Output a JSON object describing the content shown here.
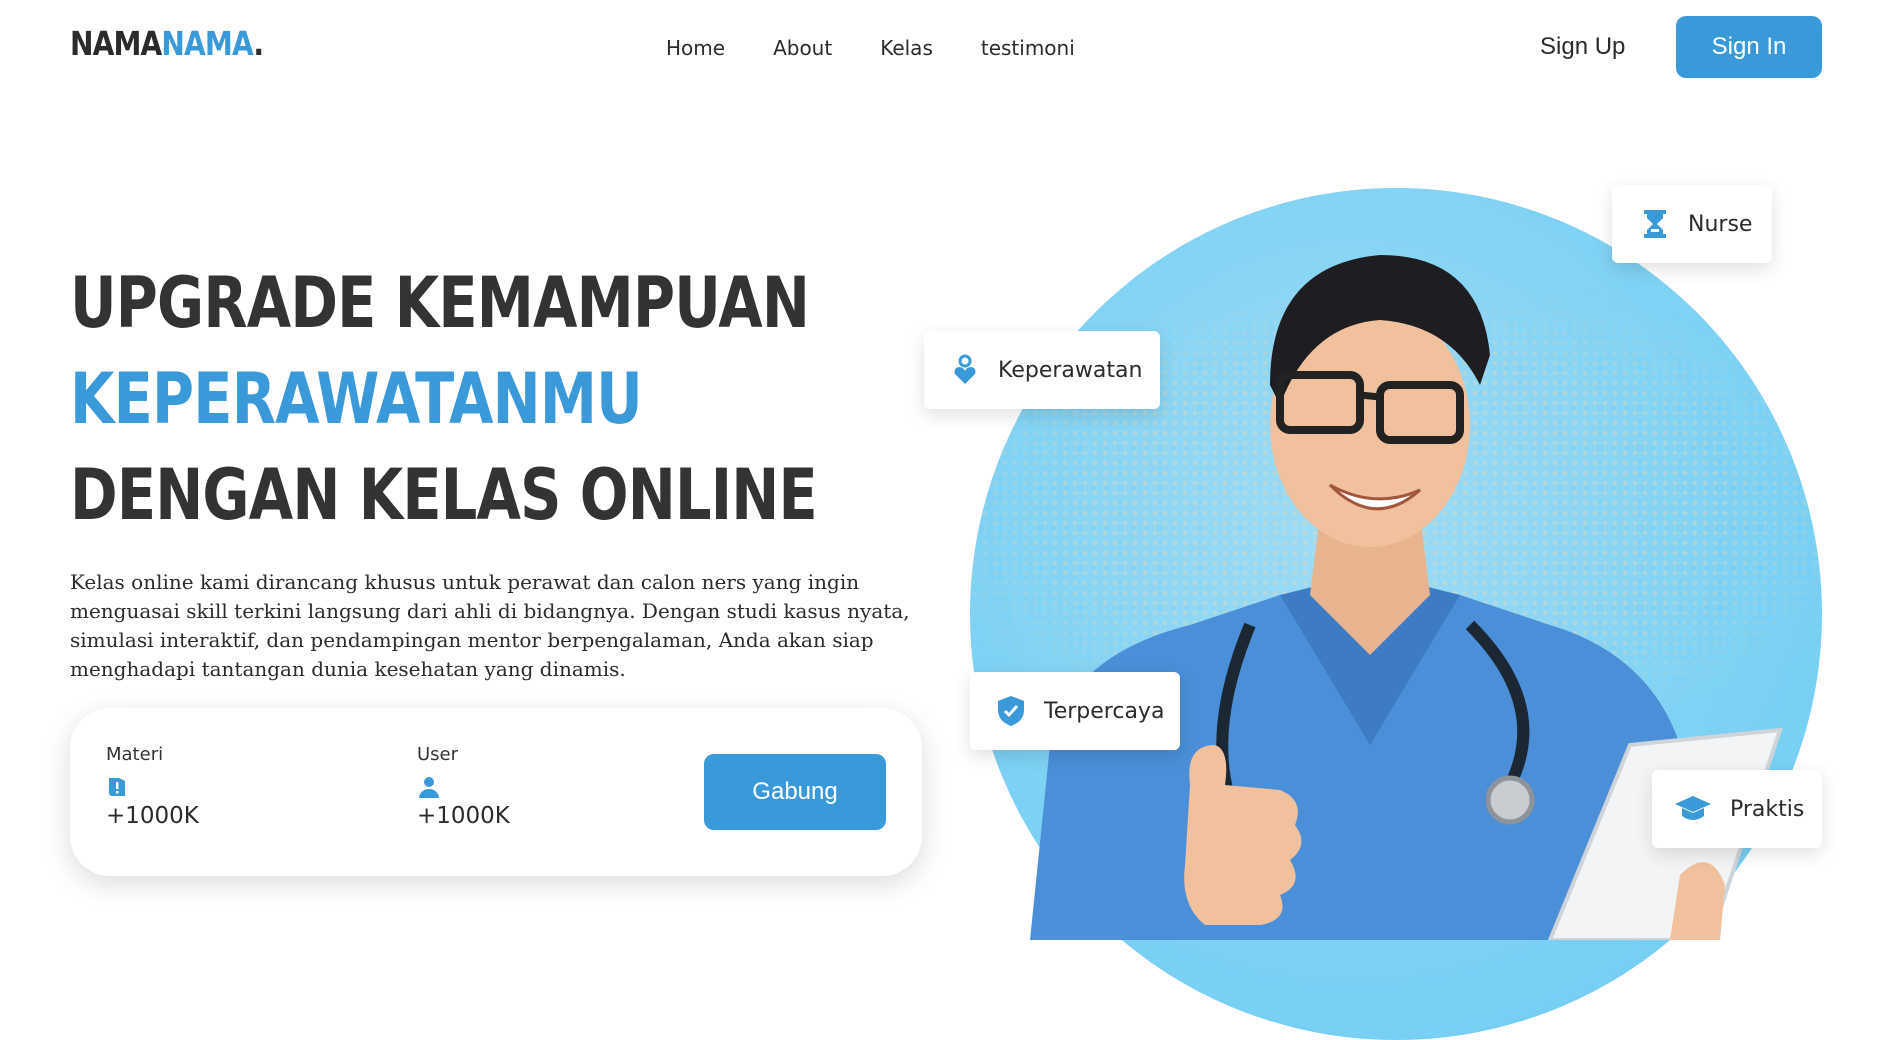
{
  "nav": {
    "logo_part1": "NAMA",
    "logo_part2": "NAMA",
    "logo_dot": ".",
    "links": [
      "Home",
      "About",
      "Kelas",
      "testimoni"
    ],
    "sign_up": "Sign Up",
    "sign_in": "Sign In"
  },
  "hero": {
    "line1": "UPGRADE KEMAMPUAN",
    "line2": "KEPERAWATANMU",
    "line3": "DENGAN KELAS ONLINE",
    "description": "Kelas online kami dirancang khusus untuk perawat dan calon ners yang ingin menguasai skill terkini langsung dari ahli di bidangnya. Dengan studi kasus nyata, simulasi interaktif, dan pendampingan mentor berpengalaman, Anda akan siap menghadapi tantangan dunia kesehatan yang dinamis."
  },
  "stats": {
    "materi": {
      "label": "Materi",
      "value": "+1000K",
      "icon": "book-icon"
    },
    "user": {
      "label": "User",
      "value": "+1000K",
      "icon": "user-icon"
    },
    "cta": "Gabung"
  },
  "badges": {
    "nurse": {
      "label": "Nurse",
      "icon": "hourglass-icon"
    },
    "keperawatan": {
      "label": "Keperawatan",
      "icon": "caregiver-icon"
    },
    "terpercaya": {
      "label": "Terpercaya",
      "icon": "shield-check-icon"
    },
    "praktis": {
      "label": "Praktis",
      "icon": "graduation-cap-icon"
    }
  },
  "colors": {
    "accent": "#3a9ad9",
    "text": "#2b2b2b",
    "circle": "#7fd2f4",
    "scrubs": "#4a8fd8"
  }
}
